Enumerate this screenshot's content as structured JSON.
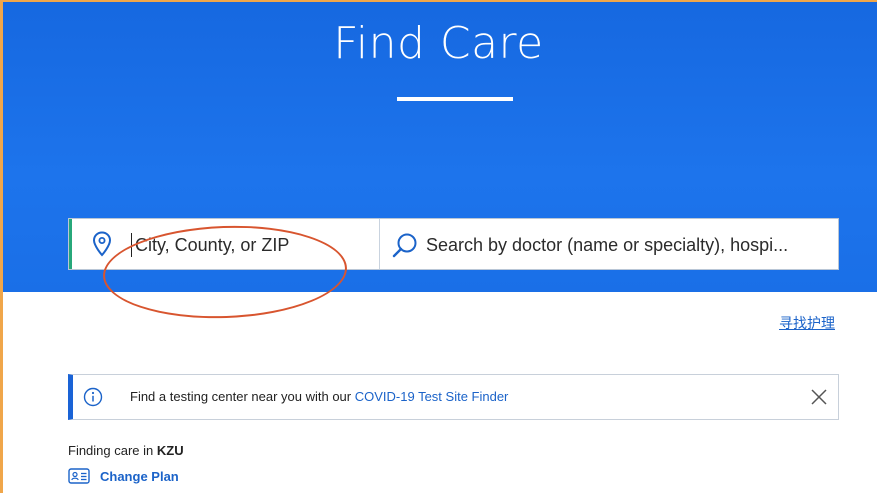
{
  "hero": {
    "title": "Find Care"
  },
  "search": {
    "location_placeholder": "City, County, or ZIP",
    "term_placeholder": "Search by doctor (name or specialty), hospi..."
  },
  "language_link": "寻找护理",
  "alert": {
    "text": "Find a testing center near you with our ",
    "link_label": "COVID-19 Test Site Finder"
  },
  "plan": {
    "prefix": "Finding care in ",
    "plan_code": "KZU",
    "change_label": "Change Plan"
  },
  "colors": {
    "hero_blue": "#1a6fe7",
    "link_blue": "#1b63c9",
    "focus_green": "#27a87a",
    "annotation_red": "#d8552f"
  }
}
